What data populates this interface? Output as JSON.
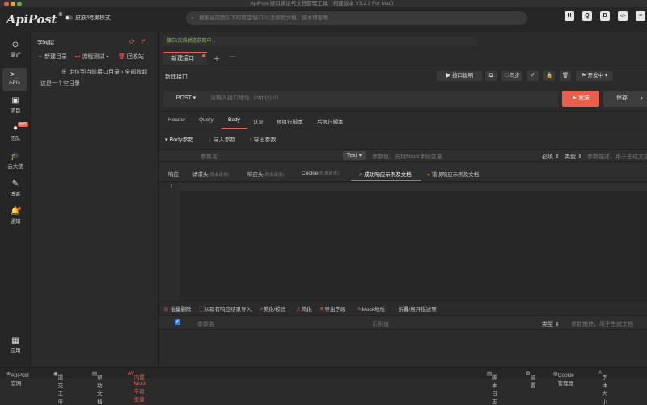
{
  "window": {
    "title": "ApiPost 接口调试与文档管理工具（构建版本 V3.2.3 For Mac）"
  },
  "brand": {
    "logo": "ApiPost",
    "mark": "®"
  },
  "topbar": {
    "skin_label": "皮肤/暗黑模式",
    "search_placeholder": "搜索当前团队下的项目/接口/以及帮助文档、技术博客等...",
    "icons": [
      "H",
      "Q",
      "B",
      "</>",
      "≡"
    ]
  },
  "sidebar": {
    "items": [
      {
        "label": "最近",
        "icon": "⊙"
      },
      {
        "label": "APIs",
        "icon": ">_"
      },
      {
        "label": "项目",
        "icon": "▣"
      },
      {
        "label": "团队",
        "icon": "●",
        "badge": "协作"
      },
      {
        "label": "云大使",
        "icon": "🎓"
      },
      {
        "label": "博客",
        "icon": "✎"
      },
      {
        "label": "通知",
        "icon": "🔔"
      },
      {
        "label": "应用",
        "icon": "▦"
      }
    ]
  },
  "tree": {
    "project": "学网招",
    "new_dir": "新建目录",
    "flow_test": "流程测试",
    "recycle": "回收站",
    "locate": "定位到当前接口目录",
    "collapse_all": "全部收起",
    "empty_dir": "这是一个空目录"
  },
  "main": {
    "doc_status": "接口/文档状态获取中...",
    "tab_label": "新建接口",
    "api_title": "新建接口",
    "doc_button": "接口说明",
    "sync_button": "同步",
    "env_select": "开发中",
    "method": "POST",
    "url_placeholder": "请输入接口地址（http(s)://）",
    "send": "发送",
    "save": "保存",
    "request_tabs": [
      "Header",
      "Query",
      "Body",
      "认证",
      "预执行脚本",
      "后执行脚本"
    ],
    "active_request_tab": "Body",
    "body_label": "Body参数",
    "import_params": "导入参数",
    "export_params": "导出参数",
    "param_name_ph": "参数名",
    "param_type": "Text",
    "param_value_ph": "参数值，支持Mock字段变量",
    "required": "必填",
    "type_col": "类型",
    "desc_ph": "参数描述，用于生成文档",
    "response_tabs": [
      "响应",
      "请求头",
      "(尚未请求)",
      "响应头",
      "(尚未请求)",
      "Cookie",
      "(尚未请求)",
      "成功响应示例及文档",
      "错误响应示例及文档"
    ],
    "editor_line": "1",
    "toolbar": [
      "批量删除",
      "从现有响应结果导入",
      "美化/校验",
      "简化",
      "导出字段",
      "Mock地址",
      "折叠/展开描述项"
    ],
    "table_headers": {
      "name": "参数名",
      "example": "示例值",
      "type": "类型",
      "desc": "参数描述，用于生成文档"
    }
  },
  "footer": {
    "left": [
      "ApiPost官网",
      "提交工单",
      "帮助文档",
      "内置Mock字段变量"
    ],
    "right": [
      "脚本日志",
      "设置",
      "Cookie管理器",
      "字体大小"
    ]
  },
  "colors": {
    "accent": "#e8604c",
    "bg": "#2b2b2b",
    "panel": "#262626"
  }
}
